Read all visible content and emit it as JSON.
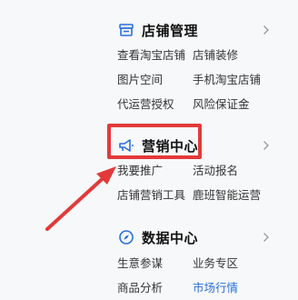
{
  "sections": [
    {
      "title": "店铺管理",
      "icon": "store-icon",
      "links": [
        "查看淘宝店铺",
        "店铺装修",
        "图片空间",
        "手机淘宝店铺",
        "代运营授权",
        "风险保证金"
      ]
    },
    {
      "title": "营销中心",
      "icon": "megaphone-icon",
      "links": [
        "我要推广",
        "活动报名",
        "店铺营销工具",
        "鹿班智能运营"
      ]
    },
    {
      "title": "数据中心",
      "icon": "compass-icon",
      "links": [
        "生意参谋",
        "业务专区",
        "商品分析",
        "市场行情"
      ]
    }
  ],
  "colors": {
    "accent": "#2a6fdb",
    "highlight": "#e23a3a",
    "text": "#333333",
    "background": "#f7f8fa"
  }
}
